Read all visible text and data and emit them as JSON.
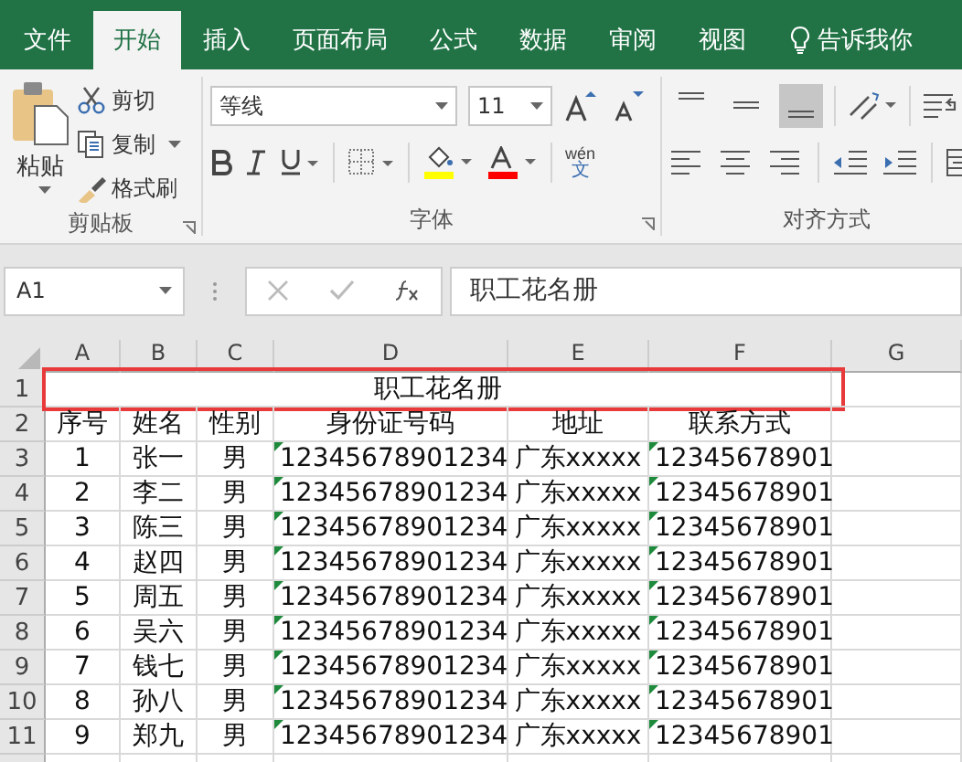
{
  "tabs": [
    {
      "label": "文件",
      "selected": false
    },
    {
      "label": "开始",
      "selected": true
    },
    {
      "label": "插入",
      "selected": false
    },
    {
      "label": "页面布局",
      "selected": false
    },
    {
      "label": "公式",
      "selected": false
    },
    {
      "label": "数据",
      "selected": false
    },
    {
      "label": "审阅",
      "selected": false
    },
    {
      "label": "视图",
      "selected": false
    }
  ],
  "tell_me": "告诉我你",
  "clipboard": {
    "paste": "粘贴",
    "cut": "剪切",
    "copy": "复制",
    "format_painter": "格式刷",
    "label": "剪贴板"
  },
  "font": {
    "name": "等线",
    "size": "11",
    "phonetic": "wén",
    "phonetic_char": "文",
    "label": "字体"
  },
  "alignment": {
    "valign": [
      {
        "kind": "top",
        "selected": false
      },
      {
        "kind": "middle",
        "selected": false
      },
      {
        "kind": "bottom",
        "selected": true
      }
    ],
    "label": "对齐方式"
  },
  "formula_bar": {
    "name_box": "A1",
    "content": "职工花名册"
  },
  "sheet": {
    "columns": [
      {
        "letter": "A",
        "flagged": false
      },
      {
        "letter": "B",
        "flagged": false
      },
      {
        "letter": "C",
        "flagged": false
      },
      {
        "letter": "D",
        "flagged": true
      },
      {
        "letter": "E",
        "flagged": false
      },
      {
        "letter": "F",
        "flagged": true
      },
      {
        "letter": "G",
        "flagged": false
      }
    ],
    "title": {
      "row": "1",
      "text": "职工花名册",
      "highlighted": true
    },
    "header": {
      "row": "2",
      "cells": [
        "序号",
        "姓名",
        "性别",
        "身份证号码",
        "地址",
        "联系方式"
      ]
    },
    "rows": [
      {
        "row": "3",
        "cells": [
          "1",
          "张一",
          "男",
          "12345678901234",
          "广东xxxxx",
          "12345678901"
        ]
      },
      {
        "row": "4",
        "cells": [
          "2",
          "李二",
          "男",
          "12345678901234",
          "广东xxxxx",
          "12345678901"
        ]
      },
      {
        "row": "5",
        "cells": [
          "3",
          "陈三",
          "男",
          "12345678901234",
          "广东xxxxx",
          "12345678901"
        ]
      },
      {
        "row": "6",
        "cells": [
          "4",
          "赵四",
          "男",
          "12345678901234",
          "广东xxxxx",
          "12345678901"
        ]
      },
      {
        "row": "7",
        "cells": [
          "5",
          "周五",
          "男",
          "12345678901234",
          "广东xxxxx",
          "12345678901"
        ]
      },
      {
        "row": "8",
        "cells": [
          "6",
          "吴六",
          "男",
          "12345678901234",
          "广东xxxxx",
          "12345678901"
        ]
      },
      {
        "row": "9",
        "cells": [
          "7",
          "钱七",
          "男",
          "12345678901234",
          "广东xxxxx",
          "12345678901"
        ]
      },
      {
        "row": "10",
        "cells": [
          "8",
          "孙八",
          "男",
          "12345678901234",
          "广东xxxxx",
          "12345678901"
        ]
      },
      {
        "row": "11",
        "cells": [
          "9",
          "郑九",
          "男",
          "12345678901234",
          "广东xxxxx",
          "12345678901"
        ]
      }
    ]
  }
}
